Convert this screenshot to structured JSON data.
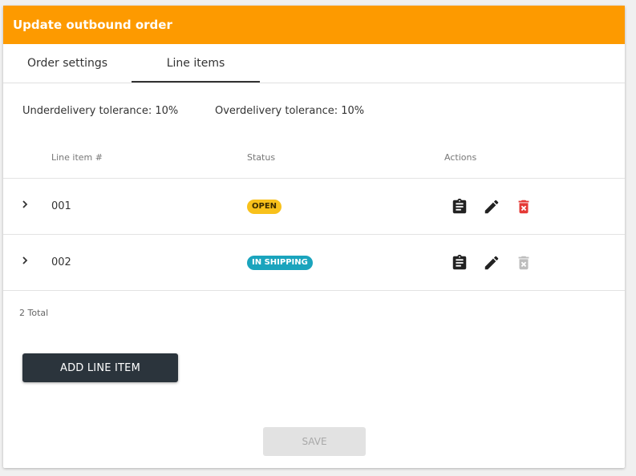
{
  "header": {
    "title": "Update outbound order",
    "color": "#fd9a00"
  },
  "tabs": [
    {
      "label": "Order settings",
      "active": false
    },
    {
      "label": "Line items",
      "active": true
    }
  ],
  "tolerances": {
    "underdelivery": "Underdelivery tolerance: 10%",
    "overdelivery": "Overdelivery tolerance: 10%"
  },
  "table": {
    "headers": {
      "line_item": "Line item #",
      "status": "Status",
      "actions": "Actions"
    },
    "rows": [
      {
        "line_item": "001",
        "status": "OPEN",
        "status_color": "#f8c11b",
        "actions": [
          "clipboard-icon",
          "edit-icon",
          "delete-icon"
        ],
        "delete_enabled": true
      },
      {
        "line_item": "002",
        "status": "IN SHIPPING",
        "status_color": "#1aa4bd",
        "actions": [
          "clipboard-icon",
          "edit-icon",
          "delete-icon"
        ],
        "delete_enabled": false
      }
    ],
    "total": "2 Total"
  },
  "buttons": {
    "add_line_item": "ADD LINE ITEM",
    "save": "SAVE",
    "save_enabled": false
  },
  "icons": {
    "expand": "chevron-right-icon",
    "delete_active_color": "#e53935",
    "delete_disabled_color": "#bdbdbd"
  }
}
